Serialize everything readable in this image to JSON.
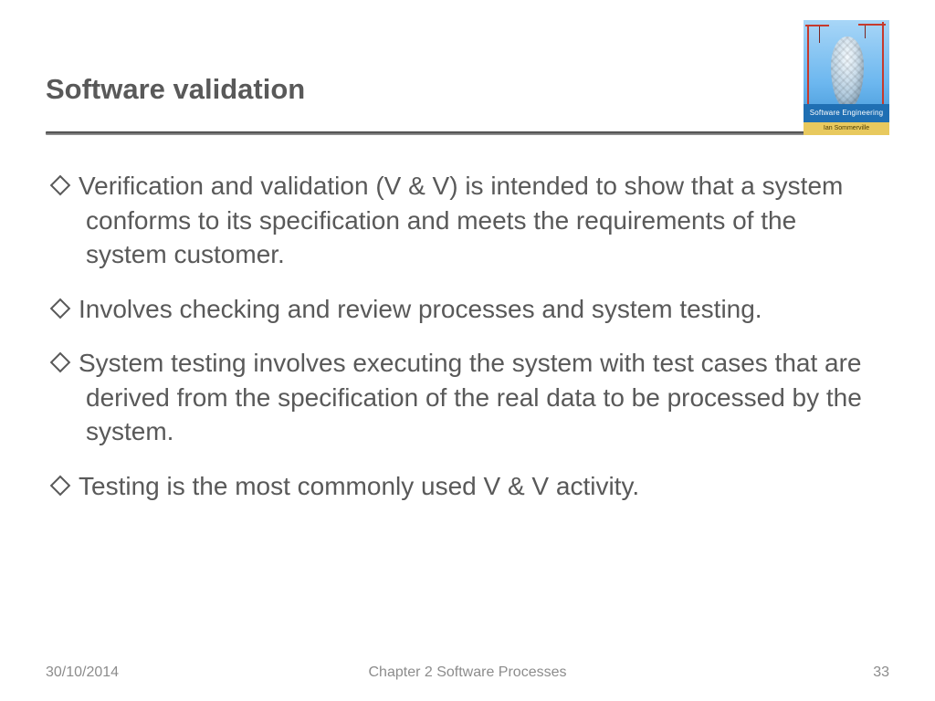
{
  "title": "Software validation",
  "book": {
    "title_line": "Software Engineering",
    "author_line": "Ian Sommerville"
  },
  "bullets": [
    "Verification and validation (V & V) is intended to show that a system conforms to its specification and meets the requirements of the system customer.",
    "Involves checking and review processes and system testing.",
    "System testing involves executing the system with test cases that are derived from the specification of the real data to be processed by the system.",
    "Testing is the most commonly used V & V activity."
  ],
  "footer": {
    "date": "30/10/2014",
    "chapter": "Chapter 2 Software Processes",
    "page": "33"
  }
}
